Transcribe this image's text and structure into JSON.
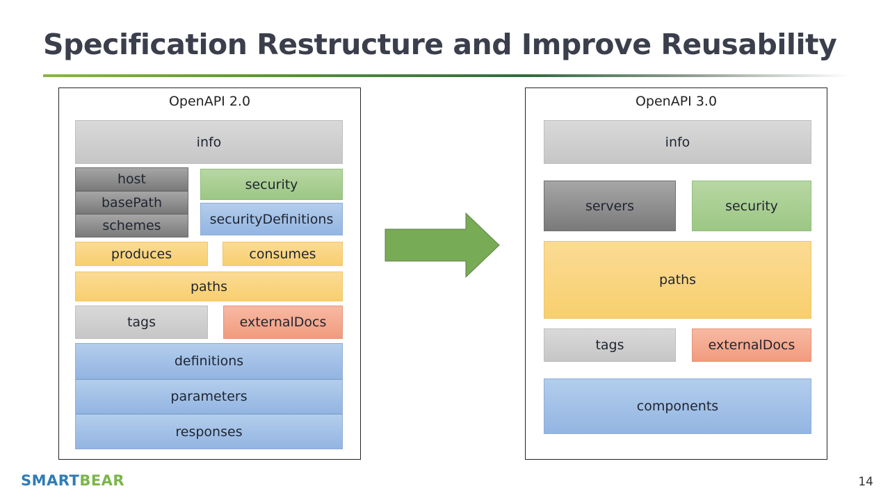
{
  "slide": {
    "title": "Specification Restructure and Improve Reusability",
    "page_number": "14",
    "logo": {
      "part1": "SMART",
      "part2": "BEAR"
    }
  },
  "colors": {
    "title_text": "#3b3f4c",
    "logo_blue": "#2f7cb4",
    "logo_green": "#7ab648",
    "arrow_green": "#78ab55",
    "gray": "#d0d0d0",
    "dark_gray": "#8a8a8a",
    "green": "#a9cf92",
    "blue": "#a3c1e8",
    "yellow": "#f9d582",
    "salmon": "#f4aa8f"
  },
  "diagram": {
    "left": {
      "title": "OpenAPI 2.0",
      "blocks": {
        "info": "info",
        "host": "host",
        "basePath": "basePath",
        "schemes": "schemes",
        "security": "security",
        "securityDefinitions": "securityDefinitions",
        "produces": "produces",
        "consumes": "consumes",
        "paths": "paths",
        "tags": "tags",
        "externalDocs": "externalDocs",
        "definitions": "definitions",
        "parameters": "parameters",
        "responses": "responses"
      }
    },
    "arrow": "right-arrow",
    "right": {
      "title": "OpenAPI 3.0",
      "blocks": {
        "info": "info",
        "servers": "servers",
        "security": "security",
        "paths": "paths",
        "tags": "tags",
        "externalDocs": "externalDocs",
        "components": "components"
      }
    }
  }
}
